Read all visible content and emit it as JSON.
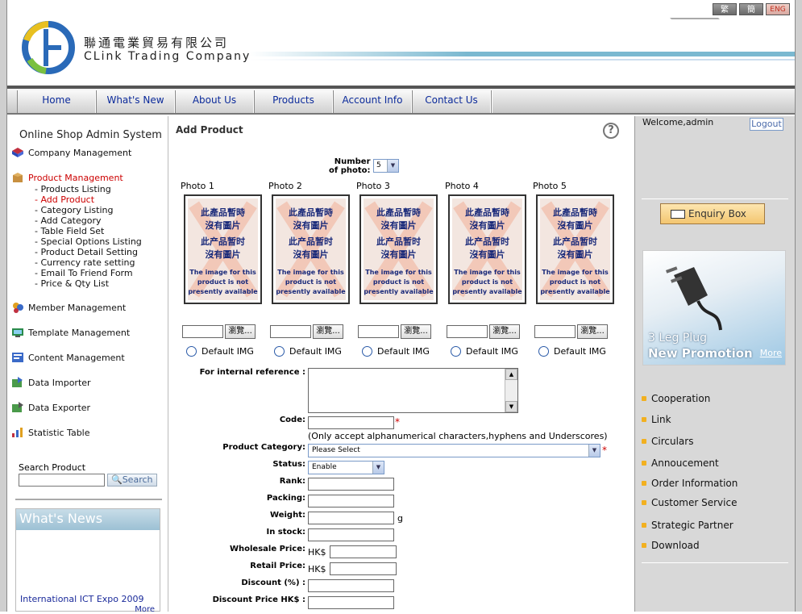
{
  "header": {
    "company_cn": "聯通電業貿易有限公司",
    "company_en": "CLink Trading Company",
    "lang_trad": "繁",
    "lang_simp": "簡",
    "lang_eng": "ENG"
  },
  "nav": [
    "Home",
    "What's New",
    "About Us",
    "Products",
    "Account Info",
    "Contact Us"
  ],
  "sidebar": {
    "title": "Online Shop Admin System",
    "company_management": "Company Management",
    "product_management": "Product Management",
    "product_sub": [
      "- Products Listing",
      "- Add Product",
      "- Category Listing",
      "- Add Category",
      "- Table Field Set",
      "- Special Options Listing",
      "- Product Detail Setting",
      "- Currency rate setting",
      "- Email To Friend Form",
      "- Price & Qty List"
    ],
    "member_management": "Member Management",
    "template_management": "Template Management",
    "content_management": "Content Management",
    "data_importer": "Data Importer",
    "data_exporter": "Data Exporter",
    "statistic_table": "Statistic Table",
    "search_label": "Search Product",
    "search_button": "Search",
    "news_title": "What's News",
    "news_item": "International ICT Expo 2009",
    "news_more": "More"
  },
  "main": {
    "title": "Add Product",
    "help": "?",
    "number_of_photo_label_1": "Number",
    "number_of_photo_label_2": "of photo:",
    "number_of_photo_value": "5",
    "photos": [
      {
        "label": "Photo 1",
        "default": "Default IMG"
      },
      {
        "label": "Photo 2",
        "default": "Default IMG"
      },
      {
        "label": "Photo 3",
        "default": "Default IMG"
      },
      {
        "label": "Photo 4",
        "default": "Default IMG"
      },
      {
        "label": "Photo 5",
        "default": "Default IMG"
      }
    ],
    "placeholder_line1": "此產品暫時",
    "placeholder_line2": "沒有圖片",
    "placeholder_line3": "此产品暂时",
    "placeholder_line4": "沒有圖片",
    "placeholder_en1": "The image for this",
    "placeholder_en2": "product is not",
    "placeholder_en3": "presently available",
    "browse_label": "瀏覽...",
    "internal_ref_label": "For internal reference :",
    "code_label": "Code:",
    "code_note": "(Only accept alphanumerical characters,hyphens and Underscores)",
    "category_label": "Product Category:",
    "category_value": "Please Select",
    "status_label": "Status:",
    "status_value": "Enable",
    "rank_label": "Rank:",
    "packing_label": "Packing:",
    "weight_label": "Weight:",
    "weight_unit": "g",
    "instock_label": "In stock:",
    "wholesale_label": "Wholesale Price:",
    "retail_label": "Retail Price:",
    "currency": "HK$",
    "discount_label": "Discount (%) :",
    "discount_price_label": "Discount Price HK$ :"
  },
  "right": {
    "welcome": "Welcome,admin",
    "logout": "Logout",
    "enquiry": "Enquiry Box",
    "promo_line1": "3 Leg Plug",
    "promo_line2": "New Promotion",
    "promo_more": "More",
    "links": [
      "Cooperation",
      "Link",
      "Circulars",
      "Annoucement",
      "Order Information",
      "Customer Service",
      "Strategic Partner",
      "Download"
    ]
  },
  "colors": {
    "accent_blue": "#0b2a9a",
    "active_red": "#cc0000",
    "required_star": "#cc0000"
  }
}
